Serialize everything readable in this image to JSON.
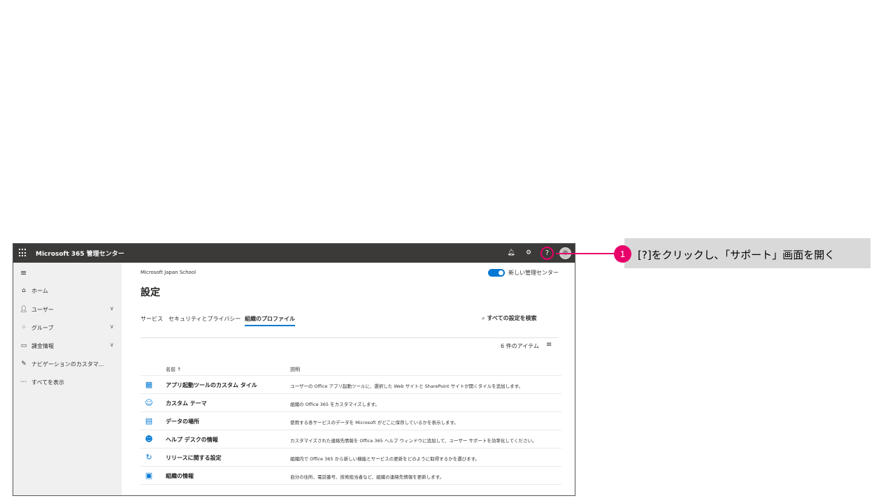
{
  "topbar": {
    "app_title": "Microsoft 365 管理センター",
    "help_glyph": "?"
  },
  "sidebar": {
    "items": [
      {
        "label": "ホーム",
        "icon": "home-icon",
        "expandable": false
      },
      {
        "label": "ユーザー",
        "icon": "user-icon",
        "expandable": true
      },
      {
        "label": "グループ",
        "icon": "group-icon",
        "expandable": true
      },
      {
        "label": "課金情報",
        "icon": "billing-icon",
        "expandable": true
      },
      {
        "label": "ナビゲーションのカスタマ...",
        "icon": "pencil-icon",
        "expandable": false
      },
      {
        "label": "すべてを表示",
        "icon": "ellipsis-icon",
        "expandable": false
      }
    ]
  },
  "main": {
    "org_name": "Microsoft Japan School",
    "toggle_label": "新しい管理センター",
    "toggle_on": true,
    "page_title": "設定",
    "tabs": [
      {
        "label": "サービス",
        "active": false
      },
      {
        "label": "セキュリティとプライバシー",
        "active": false
      },
      {
        "label": "組織のプロファイル",
        "active": true
      }
    ],
    "search_label": "すべての設定を検索",
    "item_count": "6 件のアイテム",
    "columns": {
      "name": "名前 ↑",
      "description": "説明"
    },
    "rows": [
      {
        "name": "アプリ起動ツールのカスタム タイル",
        "description": "ユーザーの Office アプリ起動ツールに、選択した Web サイトと SharePoint サイトが開くタイルを追加します。",
        "icon": "tiles-icon"
      },
      {
        "name": "カスタム テーマ",
        "description": "組織の Office 365 をカスタマイズします。",
        "icon": "palette-icon"
      },
      {
        "name": "データの場所",
        "description": "使用する各サービスのデータを Microsoft がどこに保存しているかを表示します。",
        "icon": "data-location-icon"
      },
      {
        "name": "ヘルプ デスクの情報",
        "description": "カスタマイズされた連絡先情報を Office 365 ヘルプ ウィンドウに追加して、ユーザー サポートを効率化してください。",
        "icon": "helpdesk-icon"
      },
      {
        "name": "リリースに関する設定",
        "description": "組織内で Office 365 から新しい機能とサービスの更新をどのように取得するかを選びます。",
        "icon": "sync-icon"
      },
      {
        "name": "組織の情報",
        "description": "自分の住所、電話番号、技術担当者など、組織の連絡先情報を更新します。",
        "icon": "org-info-icon"
      }
    ]
  },
  "callout": {
    "step_number": "1",
    "text": "[?]をクリックし､「サポート」画面を開く",
    "accent_color": "#e8006a"
  },
  "colors": {
    "topbar_bg": "#3b3a39",
    "sidebar_bg": "#f0f0f0",
    "accent_blue": "#0078d4"
  }
}
